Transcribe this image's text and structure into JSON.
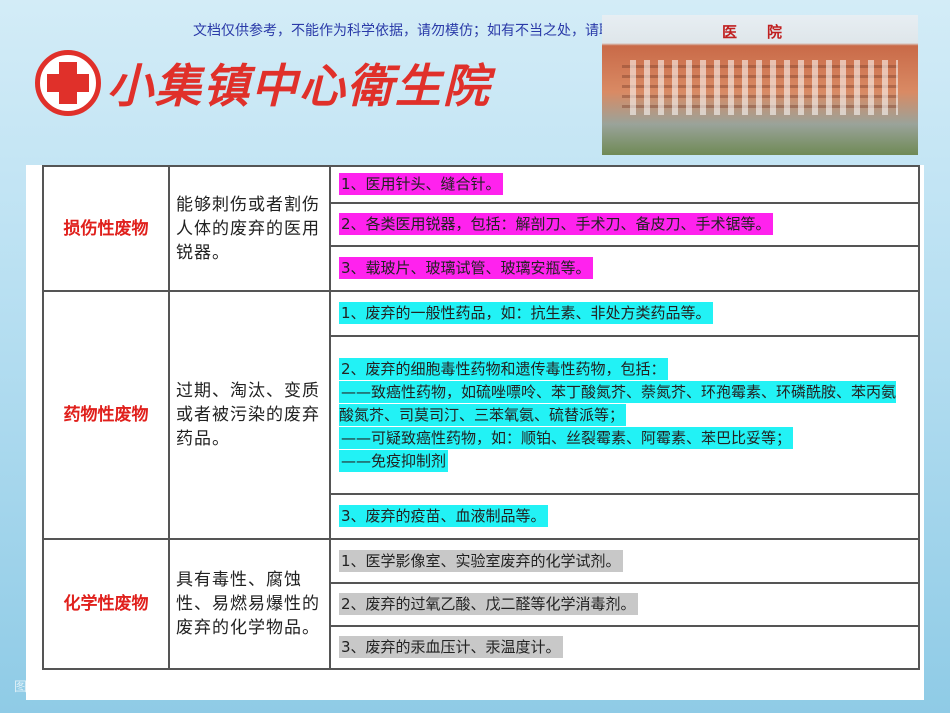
{
  "notice": "文档仅供参考，不能作为科学依据，请勿模仿；如有不当之处，请联系网站或本人删除。",
  "logo_text": "小集镇中心衛生院",
  "photo_sign": "医院",
  "colors": {
    "injury": "#ff22ee",
    "drug": "#22f2f5",
    "chemical": "#c8c8c8",
    "category": "#e0201c"
  },
  "rows": [
    {
      "category": "损伤性废物",
      "description": "能够刺伤或者割伤人体的废弃的医用锐器。",
      "items": [
        "1、医用针头、缝合针。",
        "2、各类医用锐器，包括：解剖刀、手术刀、备皮刀、手术锯等。",
        "3、载玻片、玻璃试管、玻璃安瓶等。"
      ]
    },
    {
      "category": "药物性废物",
      "description": "过期、淘汰、变质或者被污染的废弃药品。",
      "items": [
        "1、废弃的一般性药品，如：抗生素、非处方类药品等。",
        [
          "2、废弃的细胞毒性药物和遗传毒性药物，包括：",
          "——致癌性药物，如硫唑嘌呤、苯丁酸氮芥、萘氮芥、环孢霉素、环磷酰胺、苯丙氨酸氮芥、司莫司汀、三苯氧氨、硫替派等；",
          "——可疑致癌性药物，如：顺铂、丝裂霉素、阿霉素、苯巴比妥等；",
          "——免疫抑制剂"
        ],
        "3、废弃的疫苗、血液制品等。"
      ]
    },
    {
      "category": "化学性废物",
      "description": "具有毒性、腐蚀性、易燃易爆性的废弃的化学物品。",
      "items": [
        "1、医学影像室、实验室废弃的化学试剂。",
        "2、废弃的过氧乙酸、戊二醛等化学消毒剂。",
        "3、废弃的汞血压计、汞温度计。"
      ]
    }
  ],
  "footer": "图"
}
